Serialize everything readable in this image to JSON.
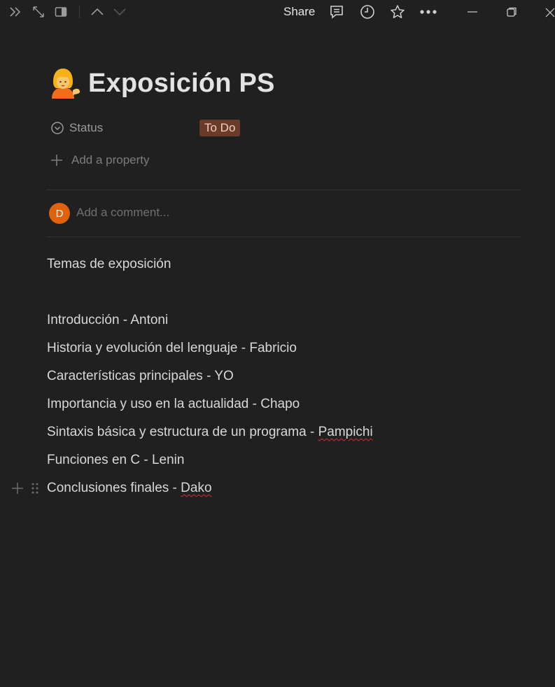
{
  "topbar": {
    "share_label": "Share"
  },
  "page": {
    "icon": "woman-tipping-hand-emoji",
    "title": "Exposición PS"
  },
  "properties": {
    "status_label": "Status",
    "status_value": "To Do",
    "status_color": "#6b3b2a",
    "add_property_label": "Add a property"
  },
  "comment": {
    "avatar_initial": "D",
    "avatar_color": "#e0620b",
    "placeholder": "Add a comment..."
  },
  "content": {
    "heading": "Temas de exposición",
    "items": [
      {
        "text": "Introducción - Antoni"
      },
      {
        "text": "Historia y evolución del lenguaje - Fabricio"
      },
      {
        "text": "Características principales - YO"
      },
      {
        "text": "Importancia y uso en la actualidad - Chapo"
      },
      {
        "text": "Sintaxis básica y estructura de un programa - ",
        "name": "Pampichi"
      },
      {
        "text": "Funciones en C - Lenin"
      },
      {
        "text": "Conclusiones finales - ",
        "name": "Dako"
      }
    ]
  }
}
